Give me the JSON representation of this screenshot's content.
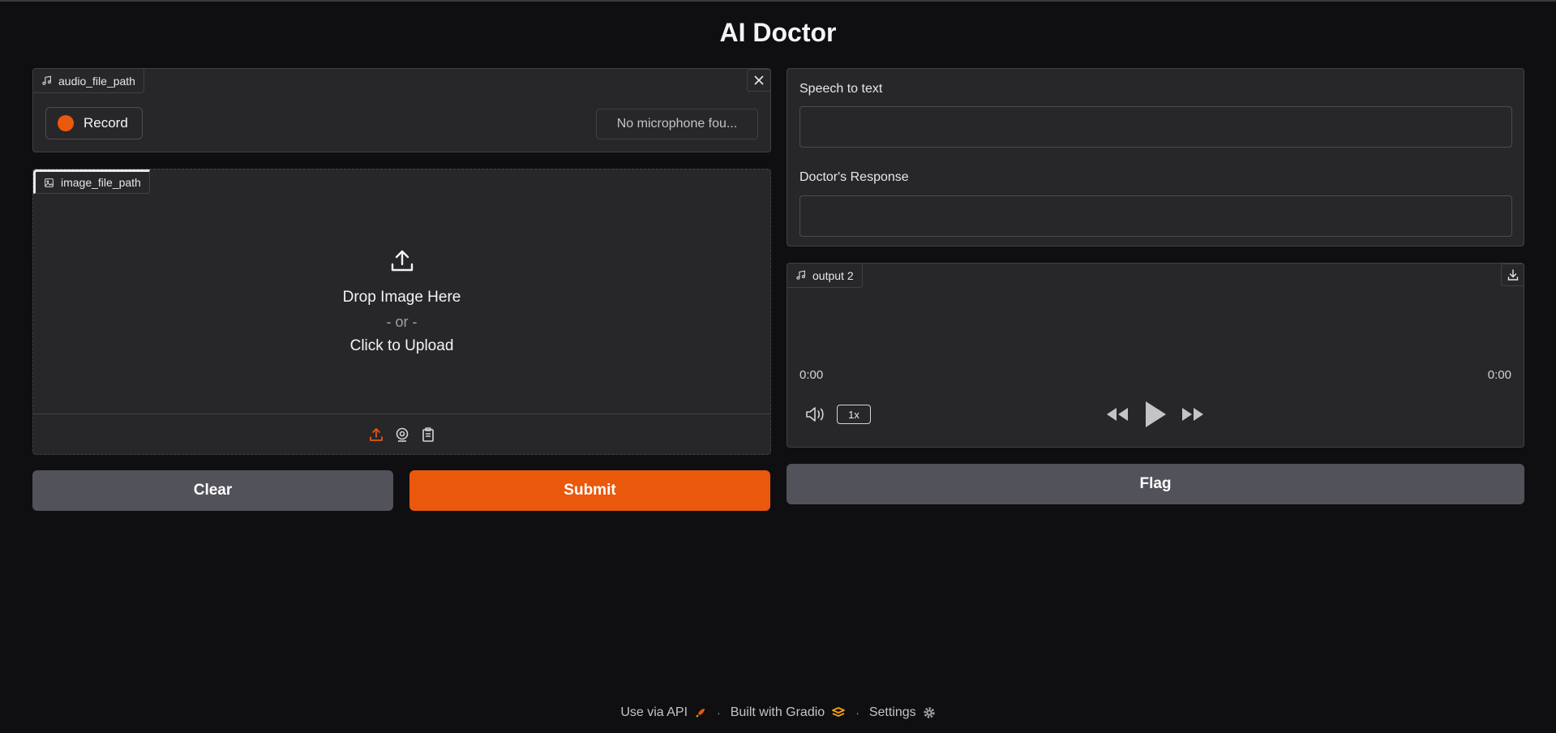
{
  "app": {
    "title": "AI Doctor"
  },
  "audio_input": {
    "label": "audio_file_path",
    "record_label": "Record",
    "mic_select_value": "No microphone fou..."
  },
  "image_input": {
    "label": "image_file_path",
    "drop_text": "Drop Image Here",
    "or_text": "- or -",
    "click_text": "Click to Upload"
  },
  "actions": {
    "clear_label": "Clear",
    "submit_label": "Submit",
    "flag_label": "Flag"
  },
  "outputs": {
    "speech_label": "Speech to text",
    "speech_value": "",
    "response_label": "Doctor's Response",
    "response_value": ""
  },
  "audio_output": {
    "label": "output 2",
    "time_current": "0:00",
    "time_total": "0:00",
    "speed": "1x"
  },
  "footer": {
    "api_label": "Use via API",
    "built_label": "Built with Gradio",
    "settings_label": "Settings",
    "separator": "·"
  },
  "colors": {
    "accent": "#ea580c",
    "background": "#0f0f11",
    "panel": "#27272a",
    "secondary_button": "#52525b"
  },
  "icons": [
    "music-note-icon",
    "close-icon",
    "record-dot-icon",
    "image-icon",
    "upload-icon",
    "webcam-icon",
    "clipboard-icon",
    "download-icon",
    "volume-icon",
    "rewind-icon",
    "play-icon",
    "fast-forward-icon",
    "rocket-icon",
    "gradio-logo-icon",
    "gear-icon"
  ]
}
